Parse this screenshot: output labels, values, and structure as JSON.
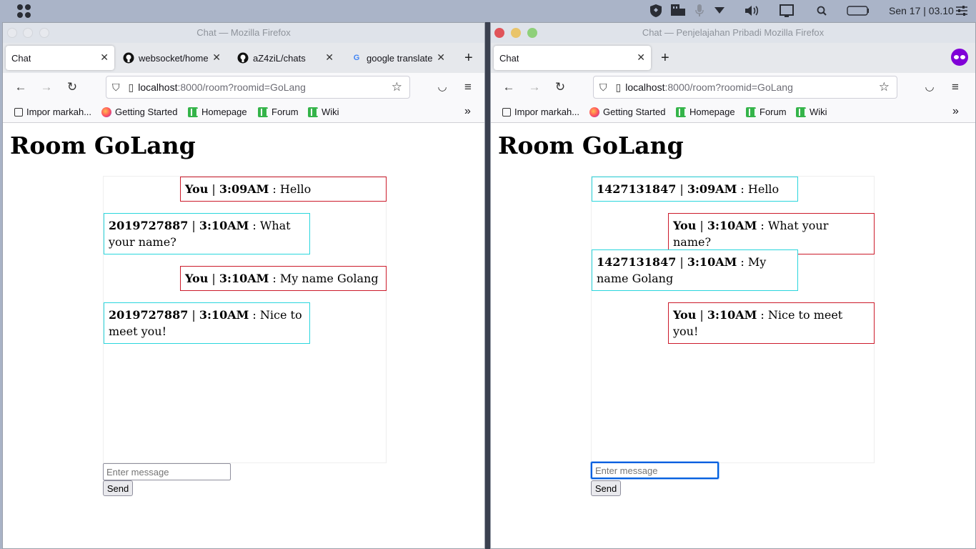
{
  "top_panel": {
    "clock": "Sen 17 | 03.10",
    "icons": [
      "apps-grid-icon",
      "shield-icon",
      "network-icon",
      "microphone-icon",
      "dropdown-icon",
      "volume-icon",
      "window-icon",
      "search-icon",
      "battery-icon",
      "settings-icon"
    ]
  },
  "left_window": {
    "title": "Chat — Mozilla Firefox",
    "tabs": [
      {
        "label": "Chat",
        "active": true
      },
      {
        "label": "websocket/home",
        "icon": "github-icon"
      },
      {
        "label": "aZ4ziL/chats",
        "icon": "github-icon"
      },
      {
        "label": "google translate",
        "icon": "google-icon"
      }
    ],
    "url_host": "localhost",
    "url_path": ":8000/room?roomid=GoLang",
    "bookmarks": [
      "Impor markah...",
      "Getting Started",
      "Homepage",
      "Forum",
      "Wiki"
    ],
    "room_title": "Room GoLang",
    "messages": [
      {
        "sender": "You",
        "time": "3:09AM",
        "text": "Hello",
        "mine": true
      },
      {
        "sender": "2019727887",
        "time": "3:10AM",
        "text": "What your name?",
        "mine": false
      },
      {
        "sender": "You",
        "time": "3:10AM",
        "text": "My name Golang",
        "mine": true
      },
      {
        "sender": "2019727887",
        "time": "3:10AM",
        "text": "Nice to meet you!",
        "mine": false
      }
    ],
    "input_placeholder": "Enter message",
    "send_label": "Send"
  },
  "right_window": {
    "title": "Chat — Penjelajahan Pribadi Mozilla Firefox",
    "tabs": [
      {
        "label": "Chat",
        "active": true
      }
    ],
    "url_host": "localhost",
    "url_path": ":8000/room?roomid=GoLang",
    "bookmarks": [
      "Impor markah...",
      "Getting Started",
      "Homepage",
      "Forum",
      "Wiki"
    ],
    "room_title": "Room GoLang",
    "messages": [
      {
        "sender": "1427131847",
        "time": "3:09AM",
        "text": "Hello",
        "mine": false
      },
      {
        "sender": "You",
        "time": "3:10AM",
        "text": "What your name?",
        "mine": true
      },
      {
        "sender": "1427131847",
        "time": "3:10AM",
        "text": "My name Golang",
        "mine": false
      },
      {
        "sender": "You",
        "time": "3:10AM",
        "text": "Nice to meet you!",
        "mine": true
      }
    ],
    "input_placeholder": "Enter message",
    "send_label": "Send"
  },
  "colors": {
    "mine_border": "#cc1b2b",
    "other_border": "#2ad6dd",
    "private_accent": "#8000d7"
  }
}
